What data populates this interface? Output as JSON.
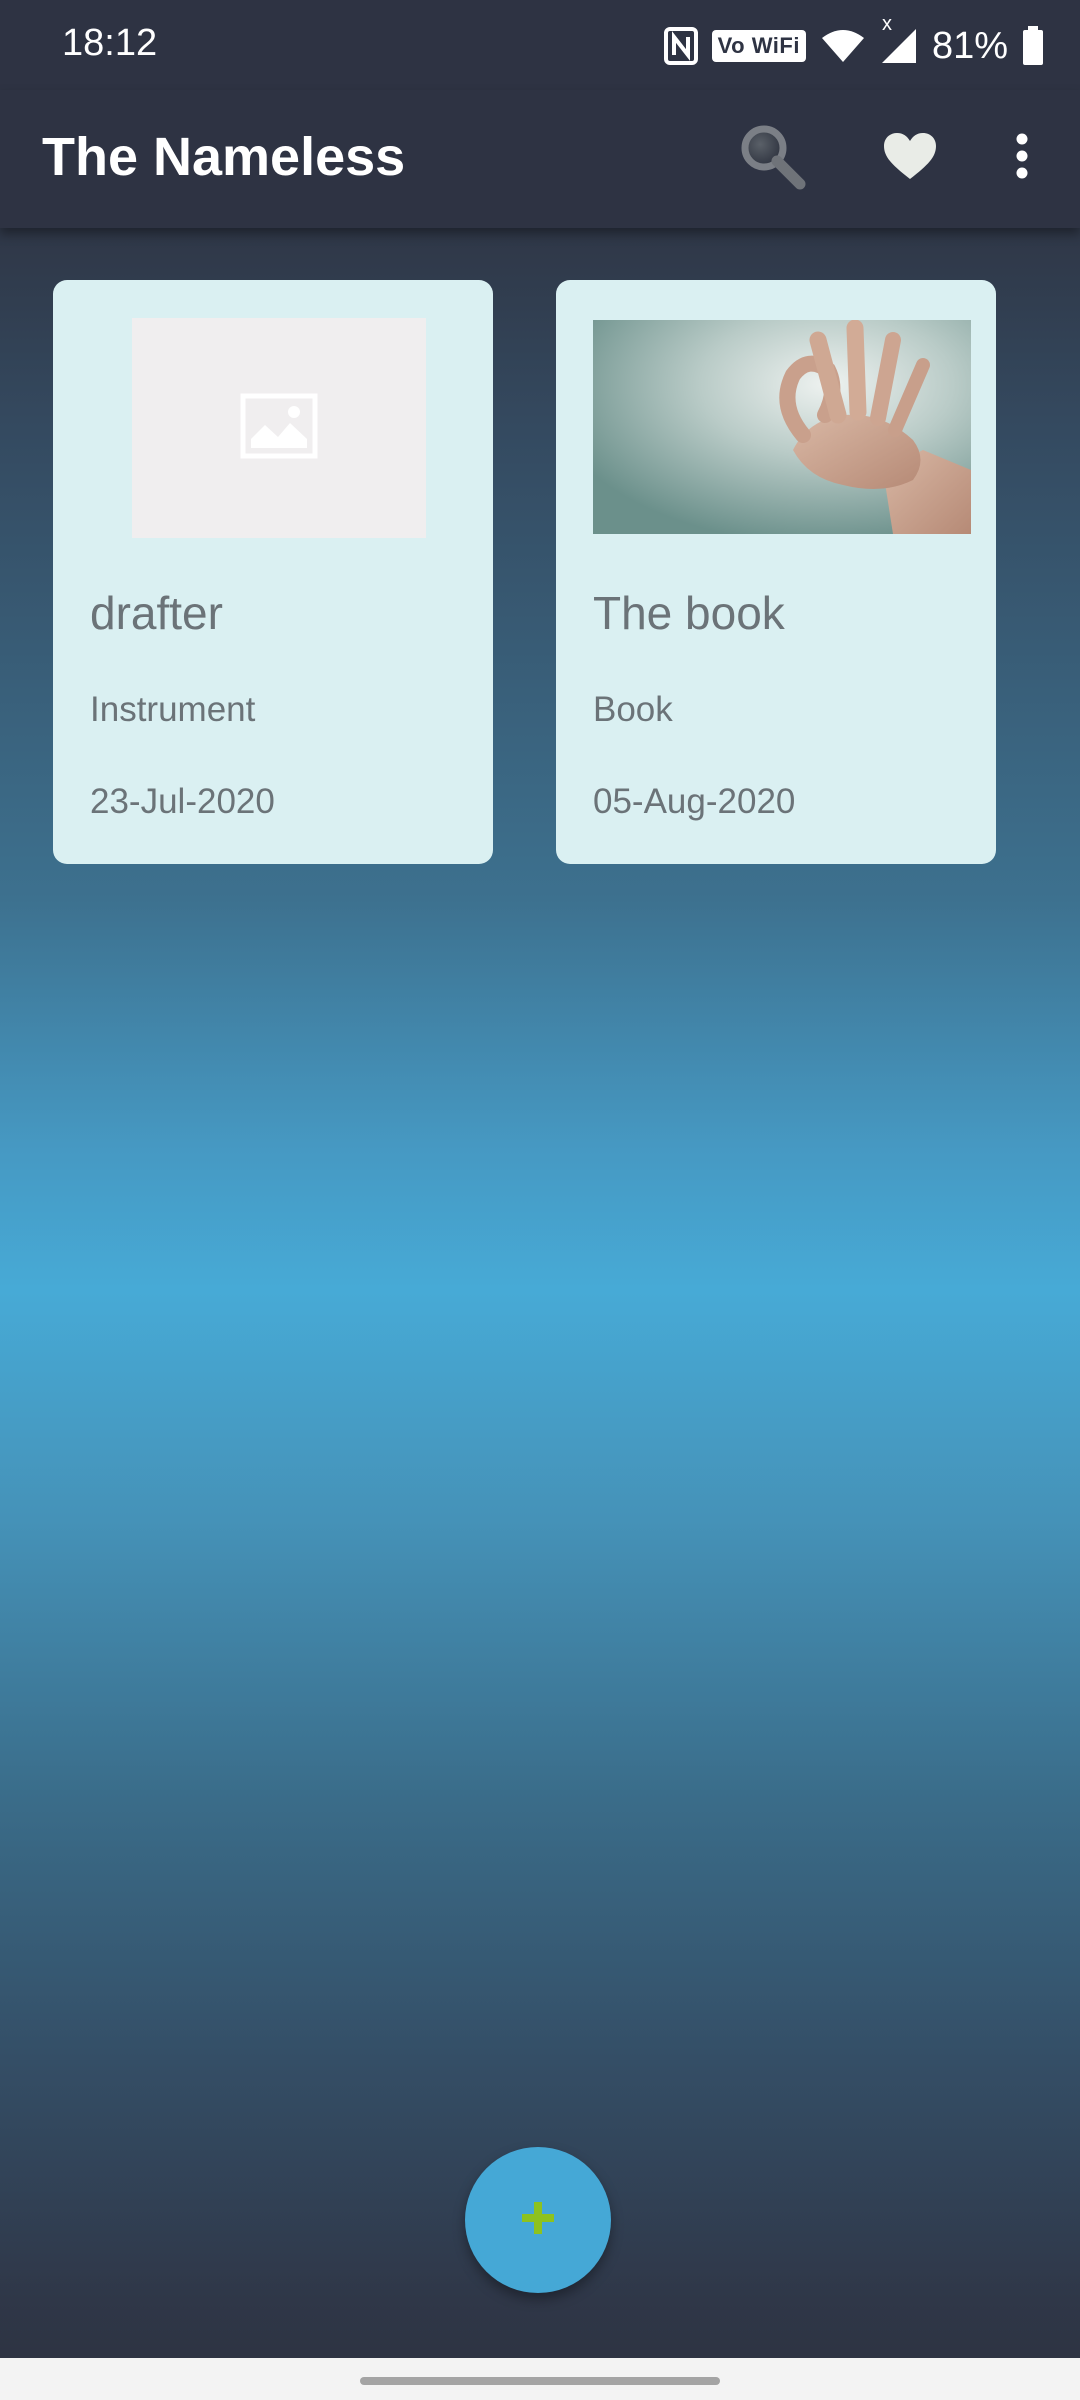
{
  "status_bar": {
    "time": "18:12",
    "vowifi_label": "Vo WiFi",
    "signal_marker": "x",
    "battery": "81%",
    "icons": [
      "nfc-icon",
      "vowifi-icon",
      "wifi-icon",
      "signal-icon",
      "battery-icon"
    ]
  },
  "app_bar": {
    "title": "The Nameless",
    "actions": [
      "search-icon",
      "heart-icon",
      "more-vertical-icon"
    ]
  },
  "items": [
    {
      "name": "drafter",
      "category": "Instrument",
      "date": "23-Jul-2020",
      "thumbnail": "image-placeholder-icon"
    },
    {
      "name": "The book",
      "category": "Book",
      "date": "05-Aug-2020",
      "thumbnail": "photo-ok-hand"
    }
  ],
  "fab": {
    "icon": "plus-icon",
    "icon_color": "#8dc21f"
  },
  "colors": {
    "app_bar": "#2e3343",
    "card_bg": "#daf0f2",
    "card_text": "#6b7378",
    "fab_bg": "#45a8d6"
  }
}
